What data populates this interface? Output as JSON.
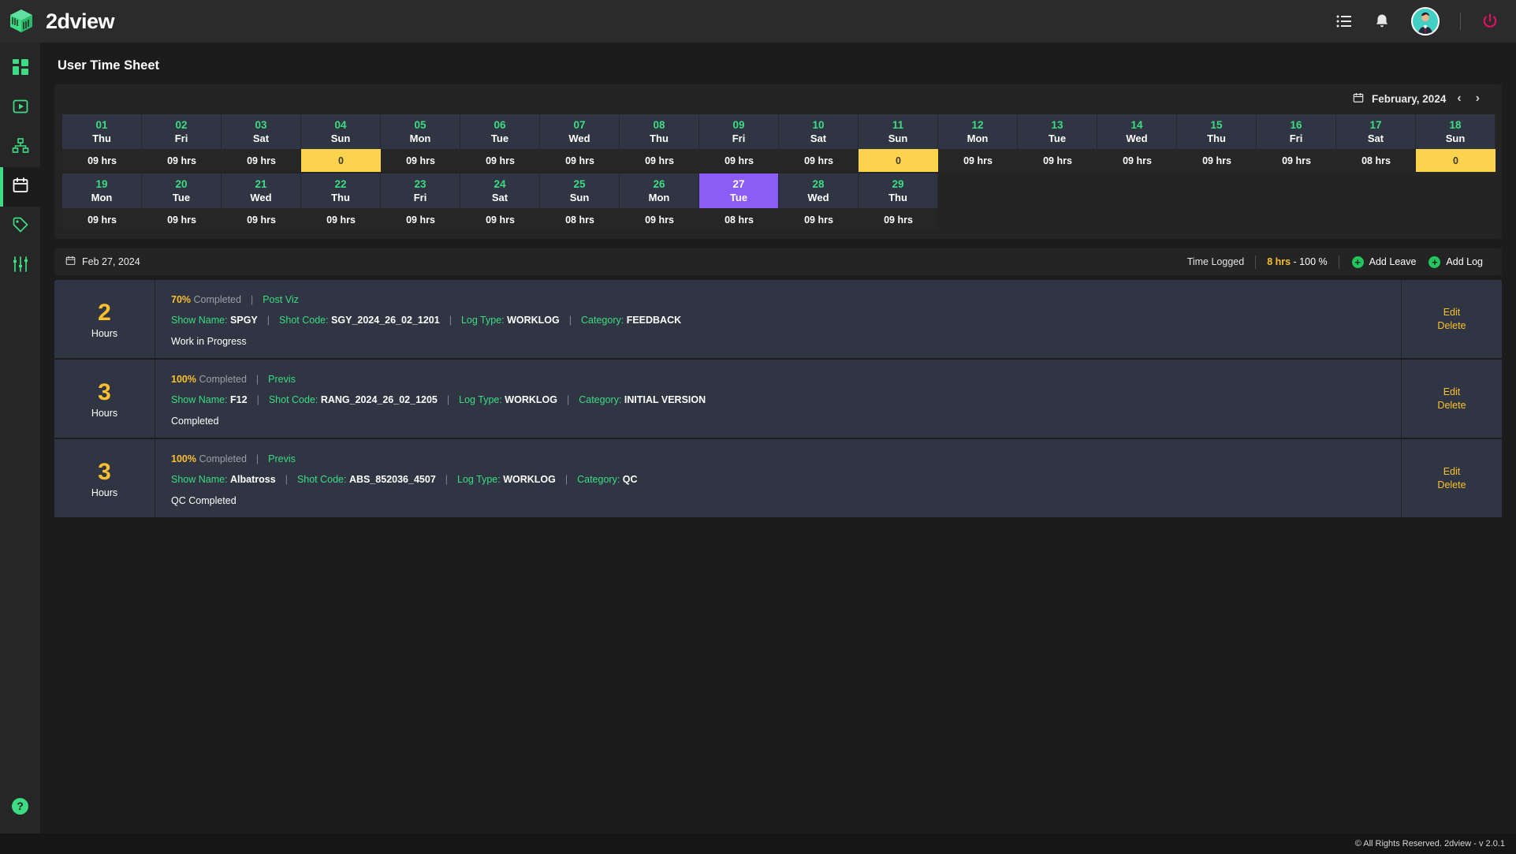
{
  "topbar": {
    "brand": "2dview",
    "icons": [
      "list-icon",
      "bell-icon",
      "avatar",
      "power-icon"
    ]
  },
  "sidebar": {
    "items": [
      {
        "name": "dashboard",
        "icon": "grid-icon",
        "active": false
      },
      {
        "name": "media",
        "icon": "play-box-icon",
        "active": false
      },
      {
        "name": "hierarchy",
        "icon": "sitemap-icon",
        "active": false
      },
      {
        "name": "timesheet",
        "icon": "calendar-icon",
        "active": true
      },
      {
        "name": "tags",
        "icon": "tag-icon",
        "active": false
      },
      {
        "name": "settings",
        "icon": "sliders-icon",
        "active": false
      }
    ],
    "help_label": "?"
  },
  "page": {
    "title": "User Time Sheet"
  },
  "calendar": {
    "month_label": "February, 2024",
    "prev_label": "‹",
    "next_label": "›",
    "selected_day": 27,
    "days": [
      {
        "num": "01",
        "day": "Thu",
        "hours": "09 hrs",
        "zero": false
      },
      {
        "num": "02",
        "day": "Fri",
        "hours": "09 hrs",
        "zero": false
      },
      {
        "num": "03",
        "day": "Sat",
        "hours": "09 hrs",
        "zero": false
      },
      {
        "num": "04",
        "day": "Sun",
        "hours": "0",
        "zero": true
      },
      {
        "num": "05",
        "day": "Mon",
        "hours": "09 hrs",
        "zero": false
      },
      {
        "num": "06",
        "day": "Tue",
        "hours": "09 hrs",
        "zero": false
      },
      {
        "num": "07",
        "day": "Wed",
        "hours": "09 hrs",
        "zero": false
      },
      {
        "num": "08",
        "day": "Thu",
        "hours": "09 hrs",
        "zero": false
      },
      {
        "num": "09",
        "day": "Fri",
        "hours": "09 hrs",
        "zero": false
      },
      {
        "num": "10",
        "day": "Sat",
        "hours": "09 hrs",
        "zero": false
      },
      {
        "num": "11",
        "day": "Sun",
        "hours": "0",
        "zero": true
      },
      {
        "num": "12",
        "day": "Mon",
        "hours": "09 hrs",
        "zero": false
      },
      {
        "num": "13",
        "day": "Tue",
        "hours": "09 hrs",
        "zero": false
      },
      {
        "num": "14",
        "day": "Wed",
        "hours": "09 hrs",
        "zero": false
      },
      {
        "num": "15",
        "day": "Thu",
        "hours": "09 hrs",
        "zero": false
      },
      {
        "num": "16",
        "day": "Fri",
        "hours": "09 hrs",
        "zero": false
      },
      {
        "num": "17",
        "day": "Sat",
        "hours": "08 hrs",
        "zero": false
      },
      {
        "num": "18",
        "day": "Sun",
        "hours": "0",
        "zero": true
      },
      {
        "num": "19",
        "day": "Mon",
        "hours": "09 hrs",
        "zero": false
      },
      {
        "num": "20",
        "day": "Tue",
        "hours": "09 hrs",
        "zero": false
      },
      {
        "num": "21",
        "day": "Wed",
        "hours": "09 hrs",
        "zero": false
      },
      {
        "num": "22",
        "day": "Thu",
        "hours": "09 hrs",
        "zero": false
      },
      {
        "num": "23",
        "day": "Fri",
        "hours": "09 hrs",
        "zero": false
      },
      {
        "num": "24",
        "day": "Sat",
        "hours": "09 hrs",
        "zero": false
      },
      {
        "num": "25",
        "day": "Sun",
        "hours": "08 hrs",
        "zero": false
      },
      {
        "num": "26",
        "day": "Mon",
        "hours": "09 hrs",
        "zero": false
      },
      {
        "num": "27",
        "day": "Tue",
        "hours": "08 hrs",
        "zero": false,
        "selected": true
      },
      {
        "num": "28",
        "day": "Wed",
        "hours": "09 hrs",
        "zero": false
      },
      {
        "num": "29",
        "day": "Thu",
        "hours": "09 hrs",
        "zero": false
      }
    ]
  },
  "log_header": {
    "date": "Feb 27, 2024",
    "time_logged_label": "Time Logged",
    "time_logged_hours": "8 hrs",
    "time_logged_pct": " - 100 %",
    "add_leave_label": "Add Leave",
    "add_log_label": "Add Log",
    "plus_glyph": "+"
  },
  "logs": [
    {
      "hours": "2",
      "hours_label": "Hours",
      "pct": "70%",
      "pct_label": "Completed",
      "task": "Post Viz",
      "show_name_label": "Show Name:",
      "show_name": "SPGY",
      "shot_code_label": "Shot Code:",
      "shot_code": "SGY_2024_26_02_1201",
      "log_type_label": "Log Type:",
      "log_type": "WORKLOG",
      "category_label": "Category:",
      "category": "FEEDBACK",
      "note": "Work in Progress",
      "edit_label": "Edit",
      "delete_label": "Delete"
    },
    {
      "hours": "3",
      "hours_label": "Hours",
      "pct": "100%",
      "pct_label": "Completed",
      "task": "Previs",
      "show_name_label": "Show Name:",
      "show_name": "F12",
      "shot_code_label": "Shot Code:",
      "shot_code": "RANG_2024_26_02_1205",
      "log_type_label": "Log Type:",
      "log_type": "WORKLOG",
      "category_label": "Category:",
      "category": "INITIAL VERSION",
      "note": "Completed",
      "edit_label": "Edit",
      "delete_label": "Delete"
    },
    {
      "hours": "3",
      "hours_label": "Hours",
      "pct": "100%",
      "pct_label": "Completed",
      "task": "Previs",
      "show_name_label": "Show Name:",
      "show_name": "Albatross",
      "shot_code_label": "Shot Code:",
      "shot_code": "ABS_852036_4507",
      "log_type_label": "Log Type:",
      "log_type": "WORKLOG",
      "category_label": "Category:",
      "category": "QC",
      "note": "QC Completed",
      "edit_label": "Edit",
      "delete_label": "Delete"
    }
  ],
  "footer": {
    "text": "© All Rights Reserved. 2dview - v 2.0.1"
  },
  "colors": {
    "accent_green": "#3ddc84",
    "accent_yellow": "#fbc02d",
    "zero_highlight": "#fcd34d",
    "selected_purple": "#8b5cf6",
    "power_red": "#e0115f"
  }
}
